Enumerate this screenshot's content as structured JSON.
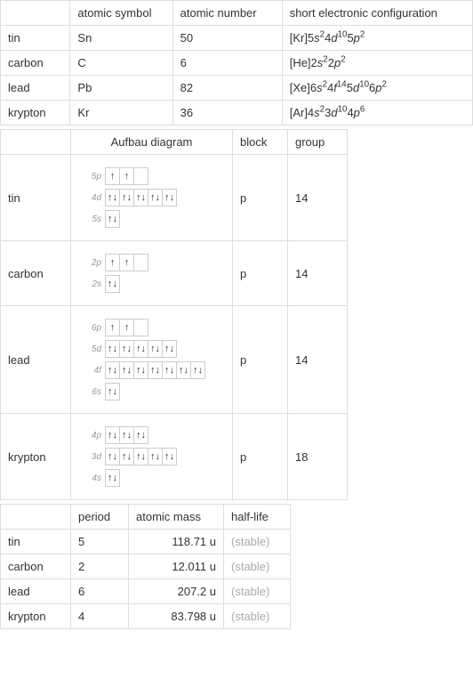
{
  "table1": {
    "headers": [
      "atomic symbol",
      "atomic number",
      "short electronic configuration"
    ],
    "rows": [
      {
        "name": "tin",
        "symbol": "Sn",
        "number": "50",
        "config_html": "[Kr]5<i>s</i><sup>2</sup>4<i>d</i><sup>10</sup>5<i>p</i><sup>2</sup>"
      },
      {
        "name": "carbon",
        "symbol": "C",
        "number": "6",
        "config_html": "[He]2<i>s</i><sup>2</sup>2<i>p</i><sup>2</sup>"
      },
      {
        "name": "lead",
        "symbol": "Pb",
        "number": "82",
        "config_html": "[Xe]6<i>s</i><sup>2</sup>4<i>f</i><sup>14</sup>5<i>d</i><sup>10</sup>6<i>p</i><sup>2</sup>"
      },
      {
        "name": "krypton",
        "symbol": "Kr",
        "number": "36",
        "config_html": "[Ar]4<i>s</i><sup>2</sup>3<i>d</i><sup>10</sup>4<i>p</i><sup>6</sup>"
      }
    ]
  },
  "table2": {
    "headers": [
      "Aufbau diagram",
      "block",
      "group"
    ],
    "rows": [
      {
        "name": "tin",
        "block": "p",
        "group": "14",
        "orbitals": [
          {
            "label": "5p",
            "boxes": [
              "↑",
              "↑",
              ""
            ]
          },
          {
            "label": "4d",
            "boxes": [
              "↑↓",
              "↑↓",
              "↑↓",
              "↑↓",
              "↑↓"
            ]
          },
          {
            "label": "5s",
            "boxes": [
              "↑↓"
            ]
          }
        ]
      },
      {
        "name": "carbon",
        "block": "p",
        "group": "14",
        "orbitals": [
          {
            "label": "2p",
            "boxes": [
              "↑",
              "↑",
              ""
            ]
          },
          {
            "label": "2s",
            "boxes": [
              "↑↓"
            ]
          }
        ]
      },
      {
        "name": "lead",
        "block": "p",
        "group": "14",
        "orbitals": [
          {
            "label": "6p",
            "boxes": [
              "↑",
              "↑",
              ""
            ]
          },
          {
            "label": "5d",
            "boxes": [
              "↑↓",
              "↑↓",
              "↑↓",
              "↑↓",
              "↑↓"
            ]
          },
          {
            "label": "4f",
            "boxes": [
              "↑↓",
              "↑↓",
              "↑↓",
              "↑↓",
              "↑↓",
              "↑↓",
              "↑↓"
            ]
          },
          {
            "label": "6s",
            "boxes": [
              "↑↓"
            ]
          }
        ]
      },
      {
        "name": "krypton",
        "block": "p",
        "group": "18",
        "orbitals": [
          {
            "label": "4p",
            "boxes": [
              "↑↓",
              "↑↓",
              "↑↓"
            ]
          },
          {
            "label": "3d",
            "boxes": [
              "↑↓",
              "↑↓",
              "↑↓",
              "↑↓",
              "↑↓"
            ]
          },
          {
            "label": "4s",
            "boxes": [
              "↑↓"
            ]
          }
        ]
      }
    ]
  },
  "table3": {
    "headers": [
      "period",
      "atomic mass",
      "half-life"
    ],
    "rows": [
      {
        "name": "tin",
        "period": "5",
        "mass": "118.71 u",
        "halflife": "(stable)"
      },
      {
        "name": "carbon",
        "period": "2",
        "mass": "12.011 u",
        "halflife": "(stable)"
      },
      {
        "name": "lead",
        "period": "6",
        "mass": "207.2 u",
        "halflife": "(stable)"
      },
      {
        "name": "krypton",
        "period": "4",
        "mass": "83.798 u",
        "halflife": "(stable)"
      }
    ]
  }
}
